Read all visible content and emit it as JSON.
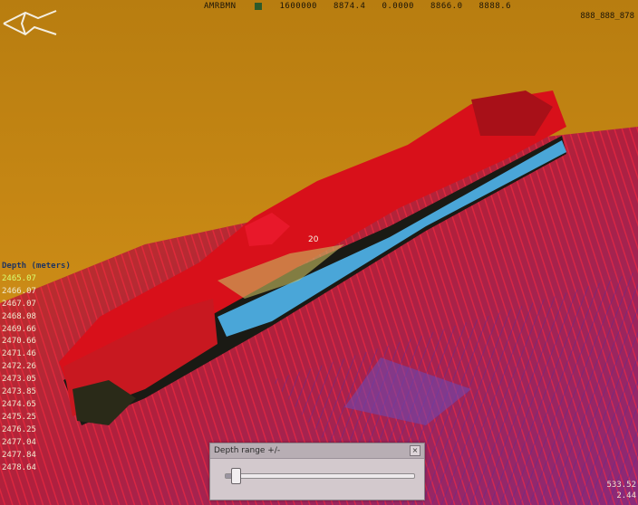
{
  "status_bar": {
    "item1": "AMRBMN",
    "item2": "1600000",
    "item3": "8874.4",
    "item4": "0.0000",
    "item5": "8866.0",
    "item6": "8888.6",
    "line2": "888_888_878",
    "swatch_color": "#2e5a2a"
  },
  "icons": {
    "orientation": "orientation-arrow-icon"
  },
  "depth_legend": {
    "title": "Depth (meters)",
    "values": [
      "2465.07",
      "2466.07",
      "2467.07",
      "2468.08",
      "2469.66",
      "2470.66",
      "2471.46",
      "2472.26",
      "2473.05",
      "2473.85",
      "2474.65",
      "2475.25",
      "2476.25",
      "2477.04",
      "2477.84",
      "2478.64"
    ]
  },
  "scene_label": "20",
  "corner_readout": {
    "line1": "533.52",
    "line2": "2.44"
  },
  "depth_dialog": {
    "title": "Depth range +/-",
    "close_label": "×",
    "slider_fraction": 0.05
  },
  "colors": {
    "background": "#c98a12",
    "seafloor": "#c01f3a",
    "wreck": "#d8101a",
    "hull_edge": "#4aa6d8",
    "legend_first": "#d8ff70"
  }
}
